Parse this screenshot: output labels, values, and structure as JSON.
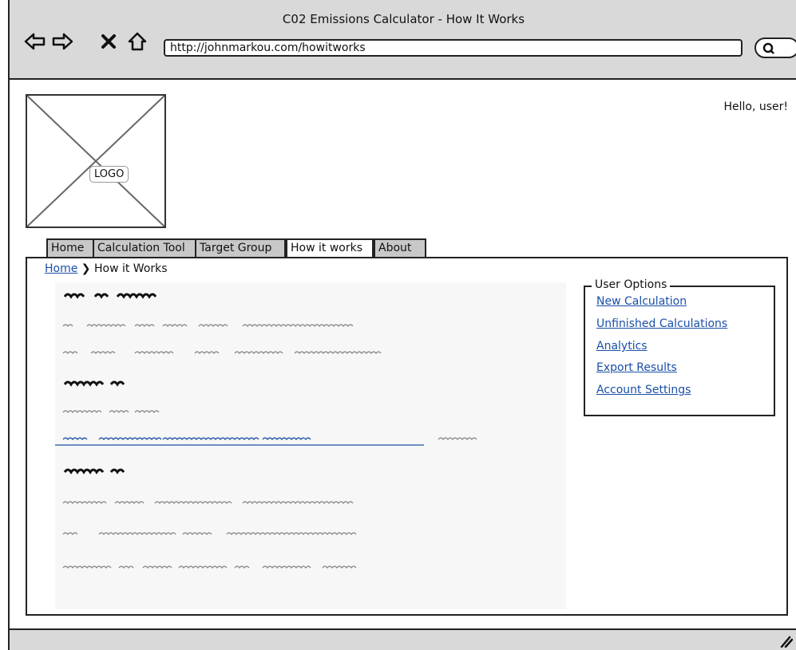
{
  "window": {
    "title": "C02 Emissions Calculator - How It Works"
  },
  "browser": {
    "url": "http://johnmarkou.com/howitworks",
    "icons": [
      "back-arrow-icon",
      "forward-arrow-icon",
      "stop-icon",
      "home-icon",
      "search-icon"
    ]
  },
  "header": {
    "logo_label": "LOGO",
    "greeting": "Hello, user!"
  },
  "tabs": [
    {
      "label": "Home",
      "active": false
    },
    {
      "label": "Calculation Tool",
      "active": false
    },
    {
      "label": "Target Group",
      "active": false
    },
    {
      "label": "How it works",
      "active": true
    },
    {
      "label": "About",
      "active": false
    }
  ],
  "breadcrumb": {
    "home": "Home",
    "separator": "❯",
    "current": "How it Works"
  },
  "user_options": {
    "legend": "User Options",
    "items": [
      {
        "label": "New Calculation"
      },
      {
        "label": "Unfinished Calculations"
      },
      {
        "label": "Analytics"
      },
      {
        "label": "Export Results"
      },
      {
        "label": "Account Settings"
      }
    ]
  },
  "colors": {
    "link": "#1a4fa8",
    "chrome": "#d9d9d9",
    "tab_inactive": "#c8c8c8"
  }
}
